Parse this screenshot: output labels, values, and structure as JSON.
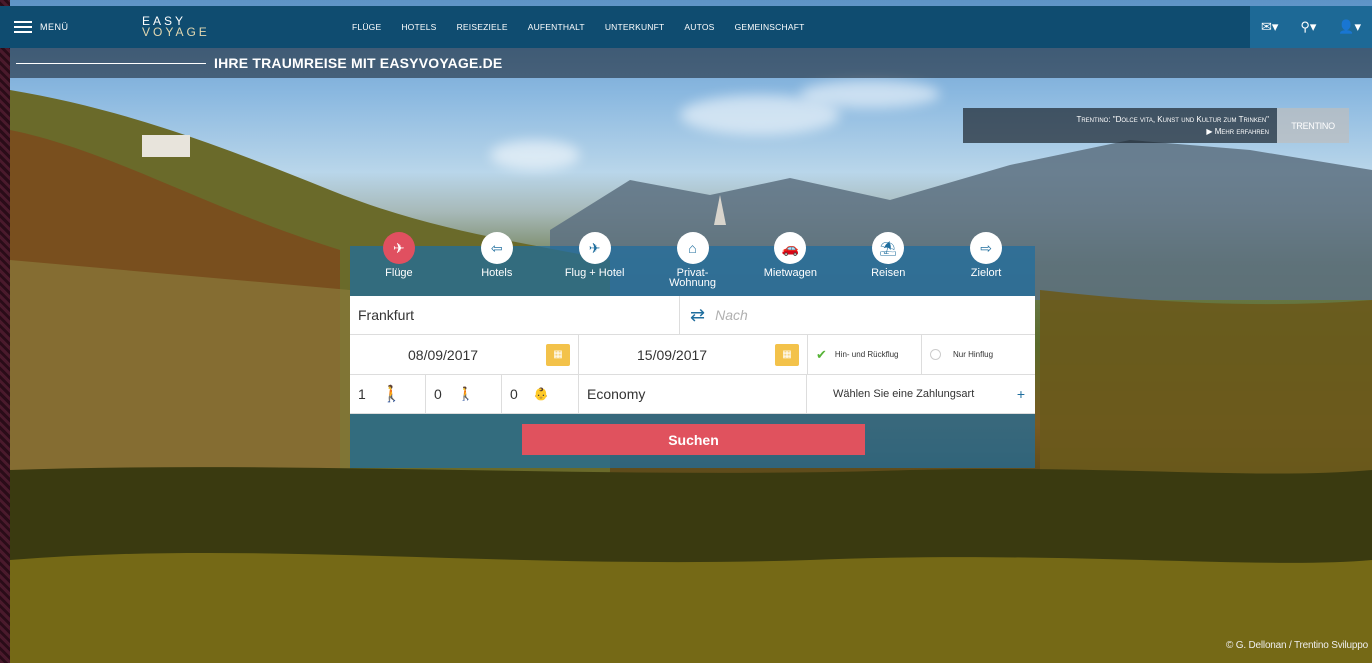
{
  "topbar": {
    "menu_label": "MENÜ",
    "logo_line1": "EASY",
    "logo_line2": "VOYAGE",
    "nav": [
      "FLÜGE",
      "HOTELS",
      "REISEZIELE",
      "AUFENTHALT",
      "UNTERKUNFT",
      "AUTOS",
      "GEMEINSCHAFT"
    ],
    "icons": [
      "mail-icon",
      "search-icon",
      "user-icon"
    ]
  },
  "tagline": "IHRE TRAUMREISE MIT EASYVOYAGE.DE",
  "promo": {
    "text": "Trentino: \"Dolce vita, Kunst und Kultur zum Trinken\"",
    "link": "▶ Mehr erfahren",
    "brand": "TRENTINO"
  },
  "widget": {
    "tabs": [
      {
        "label": "Flüge",
        "icon": "plane-icon"
      },
      {
        "label": "Hotels",
        "icon": "hotel-icon"
      },
      {
        "label": "Flug + Hotel",
        "icon": "flight-hotel-icon"
      },
      {
        "label": "Privat-\nWohnung",
        "icon": "apartment-icon"
      },
      {
        "label": "Mietwagen",
        "icon": "car-icon"
      },
      {
        "label": "Reisen",
        "icon": "travel-icon"
      },
      {
        "label": "Zielort",
        "icon": "destination-icon"
      }
    ],
    "from_value": "Frankfurt",
    "to_placeholder": "Nach",
    "depart_date": "08/09/2017",
    "return_date": "15/09/2017",
    "roundtrip_label": "Hin- und Rückflug",
    "oneway_label": "Nur Hinflug",
    "adults": "1",
    "children": "0",
    "infants": "0",
    "cabin": "Economy",
    "payment_label": "Wählen Sie eine Zahlungsart",
    "plus": "+",
    "submit": "Suchen"
  },
  "credit": "© G. Dellonan / Trentino Sviluppo"
}
